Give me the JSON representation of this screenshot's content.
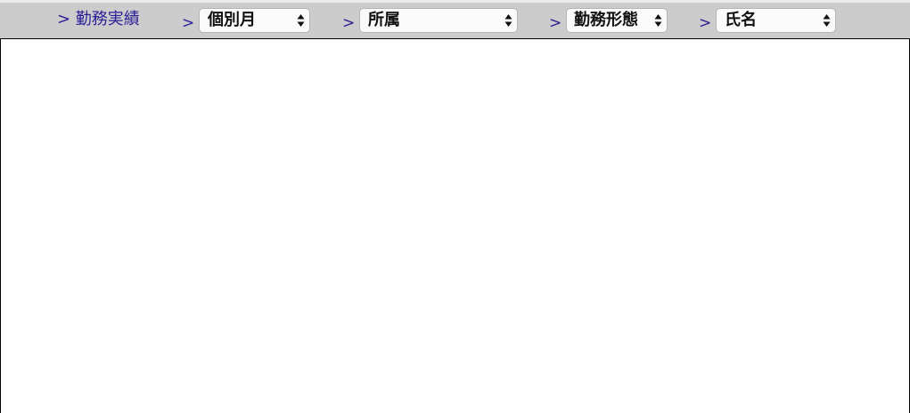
{
  "nav": {
    "breadcrumb_sep": ">",
    "root_link": "> 勤務実績",
    "selects": [
      {
        "id": "month",
        "value": "個別月"
      },
      {
        "id": "department",
        "value": "所属"
      },
      {
        "id": "work-type",
        "value": "勤務形態"
      },
      {
        "id": "name",
        "value": "氏名"
      }
    ]
  },
  "colors": {
    "link": "#2a1e96",
    "bar": "#cccccc"
  }
}
